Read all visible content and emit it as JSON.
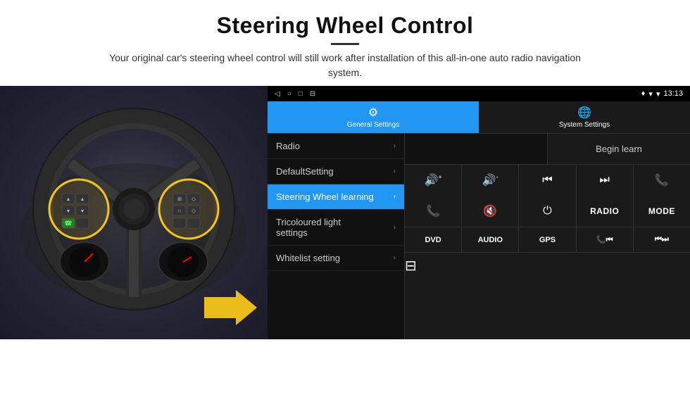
{
  "header": {
    "title": "Steering Wheel Control",
    "subtitle": "Your original car's steering wheel control will still work after installation of this all-in-one auto radio navigation system."
  },
  "status_bar": {
    "time": "13:13",
    "icons": [
      "◁",
      "○",
      "□",
      "⊟"
    ],
    "signal": "▾◆",
    "wifi": "▾"
  },
  "tabs": [
    {
      "label": "General Settings",
      "icon": "⚙",
      "active": true
    },
    {
      "label": "System Settings",
      "icon": "🌐",
      "active": false
    }
  ],
  "menu": [
    {
      "label": "Radio",
      "active": false
    },
    {
      "label": "DefaultSetting",
      "active": false
    },
    {
      "label": "Steering Wheel learning",
      "active": true
    },
    {
      "label": "Tricoloured light settings",
      "active": false
    },
    {
      "label": "Whitelist setting",
      "active": false
    }
  ],
  "controls": {
    "begin_learn": "Begin learn",
    "grid_buttons": [
      {
        "symbol": "🔊+",
        "type": "icon"
      },
      {
        "symbol": "🔊-",
        "type": "icon"
      },
      {
        "symbol": "⏮",
        "type": "icon"
      },
      {
        "symbol": "⏭",
        "type": "icon"
      },
      {
        "symbol": "📞",
        "type": "icon"
      },
      {
        "symbol": "📞",
        "type": "icon"
      },
      {
        "symbol": "🔇",
        "type": "icon"
      },
      {
        "symbol": "⏻",
        "type": "icon"
      },
      {
        "symbol": "RADIO",
        "type": "text"
      },
      {
        "symbol": "MODE",
        "type": "text"
      }
    ],
    "bottom_buttons": [
      {
        "label": "DVD",
        "type": "text"
      },
      {
        "label": "AUDIO",
        "type": "text"
      },
      {
        "label": "GPS",
        "type": "text"
      },
      {
        "label": "📞⏮",
        "type": "icon"
      },
      {
        "label": "⏮⏭",
        "type": "icon"
      }
    ],
    "extra_button": {
      "label": "⊟",
      "type": "icon"
    }
  }
}
